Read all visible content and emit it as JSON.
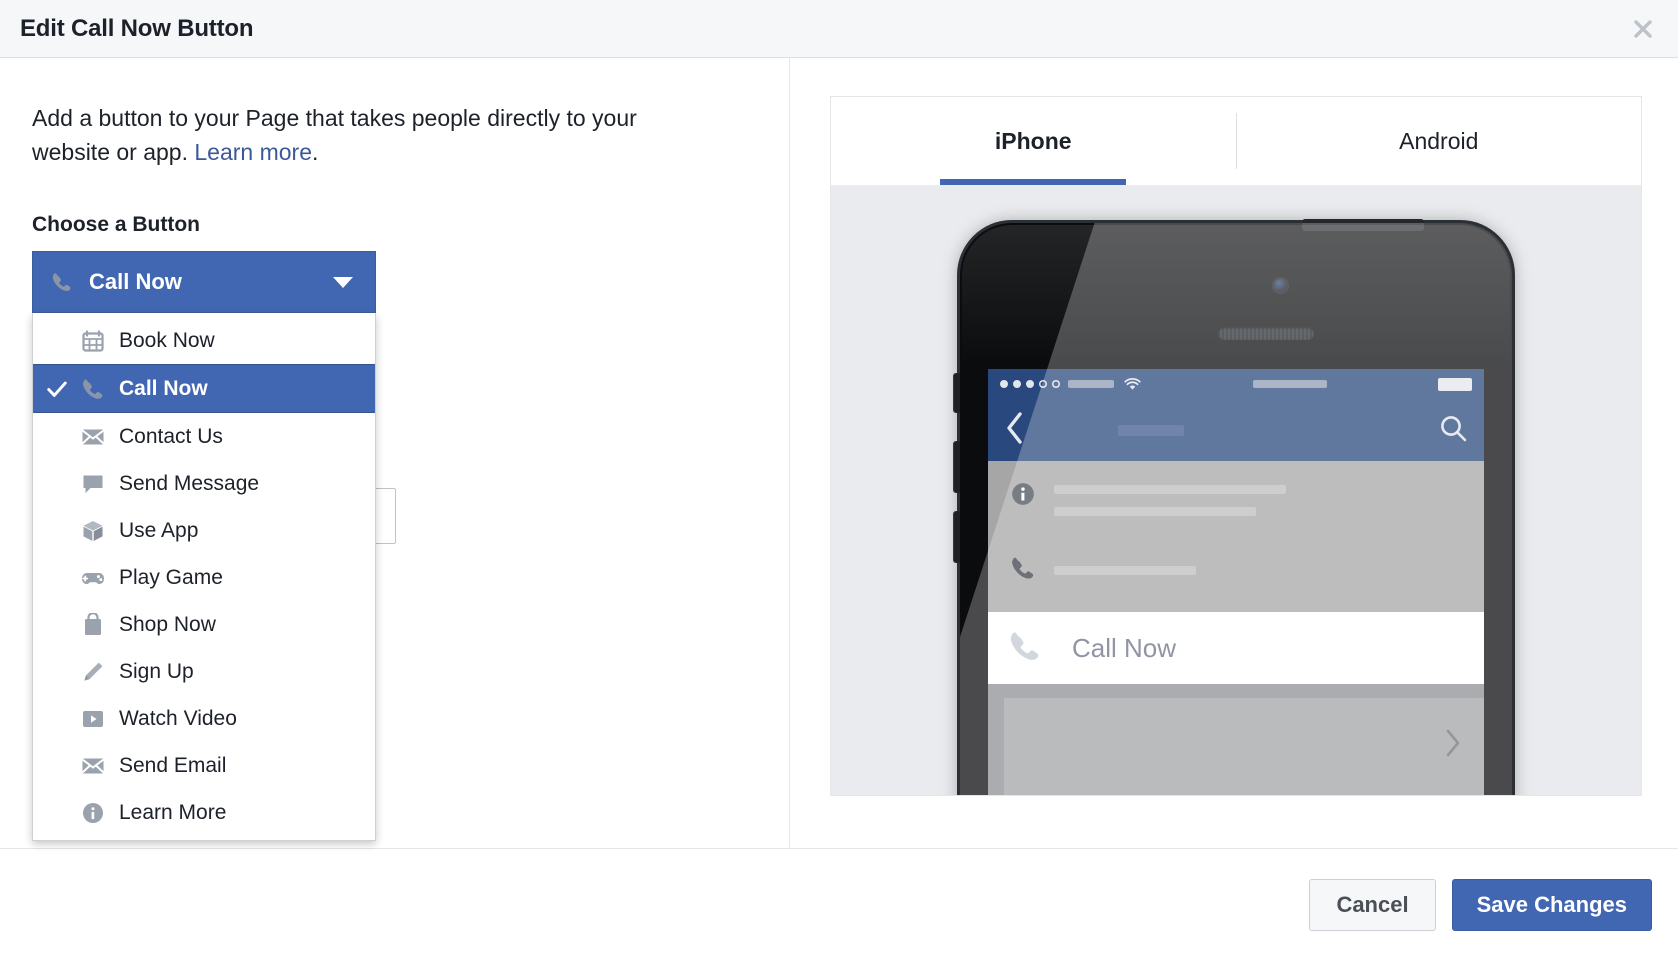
{
  "dialog": {
    "title": "Edit Call Now Button",
    "close_icon": "close-icon"
  },
  "left": {
    "intro_text_before": "Add a button to your Page that takes people directly to your website or app. ",
    "learn_more_label": "Learn more",
    "intro_text_after": ".",
    "section_label": "Choose a Button"
  },
  "dropdown": {
    "selected_label": "Call Now",
    "selected_icon": "phone-icon",
    "caret_icon": "chevron-down-icon",
    "items": [
      {
        "label": "Book Now",
        "icon": "calendar-icon",
        "selected": false
      },
      {
        "label": "Call Now",
        "icon": "phone-icon",
        "selected": true
      },
      {
        "label": "Contact Us",
        "icon": "envelope-icon",
        "selected": false
      },
      {
        "label": "Send Message",
        "icon": "chat-bubble-icon",
        "selected": false
      },
      {
        "label": "Use App",
        "icon": "cube-icon",
        "selected": false
      },
      {
        "label": "Play Game",
        "icon": "gamepad-icon",
        "selected": false
      },
      {
        "label": "Shop Now",
        "icon": "shopping-bag-icon",
        "selected": false
      },
      {
        "label": "Sign Up",
        "icon": "pencil-icon",
        "selected": false
      },
      {
        "label": "Watch Video",
        "icon": "video-play-icon",
        "selected": false
      },
      {
        "label": "Send Email",
        "icon": "envelope-icon",
        "selected": false
      },
      {
        "label": "Learn More",
        "icon": "info-icon",
        "selected": false
      }
    ]
  },
  "preview": {
    "tabs": [
      {
        "label": "iPhone",
        "active": true
      },
      {
        "label": "Android",
        "active": false
      }
    ],
    "phone": {
      "cta_label": "Call Now",
      "cta_icon": "phone-icon",
      "back_icon": "chevron-left-icon",
      "search_icon": "search-icon",
      "info_icon": "info-icon",
      "phone_row_icon": "phone-icon",
      "map_chevron_icon": "chevron-right-icon",
      "wifi_icon": "wifi-icon",
      "battery_icon": "battery-icon"
    }
  },
  "footer": {
    "cancel_label": "Cancel",
    "save_label": "Save Changes"
  },
  "colors": {
    "facebook_blue": "#4267b2",
    "nav_dark_blue": "#29487d",
    "link_blue": "#3b5998",
    "header_bg": "#f6f7f9",
    "stage_bg": "#e9ebee",
    "cta_text": "#6b7084"
  }
}
